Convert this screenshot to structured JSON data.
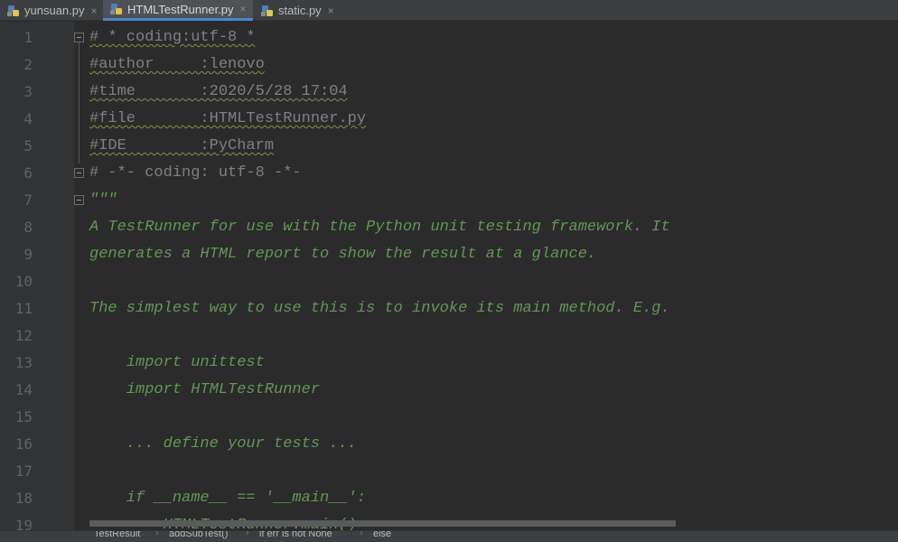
{
  "tabs": [
    {
      "label": "yunsuan.py",
      "active": false,
      "icon": "python-file-icon"
    },
    {
      "label": "HTMLTestRunner.py",
      "active": true,
      "icon": "python-file-icon"
    },
    {
      "label": "static.py",
      "active": false,
      "icon": "python-file-icon"
    }
  ],
  "close_glyph": "×",
  "editor": {
    "line_numbers": [
      "1",
      "2",
      "3",
      "4",
      "5",
      "6",
      "7",
      "8",
      "9",
      "10",
      "11",
      "12",
      "13",
      "14",
      "15",
      "16",
      "17",
      "18",
      "19"
    ],
    "lines": [
      "# * coding:utf-8 *",
      "#author     :lenovo",
      "#time       :2020/5/28 17:04",
      "#file       :HTMLTestRunner.py",
      "#IDE        :PyCharm",
      "# -*- coding: utf-8 -*-",
      "\"\"\"",
      "A TestRunner for use with the Python unit testing framework. It",
      "generates a HTML report to show the result at a glance.",
      "",
      "The simplest way to use this is to invoke its main method. E.g.",
      "",
      "    import unittest",
      "    import HTMLTestRunner",
      "",
      "    ... define your tests ...",
      "",
      "    if __name__ == '__main__':",
      "        HTMLTestRunner.main()"
    ]
  },
  "breadcrumb": [
    "TestResult",
    "addSubTest()",
    "if err is not None",
    "else"
  ],
  "breadcrumb_sep": "›",
  "colors": {
    "background": "#2b2b2b",
    "comment": "#808080",
    "docstring": "#629755",
    "line_number": "#606366",
    "active_tab_underline": "#4a88c7"
  }
}
